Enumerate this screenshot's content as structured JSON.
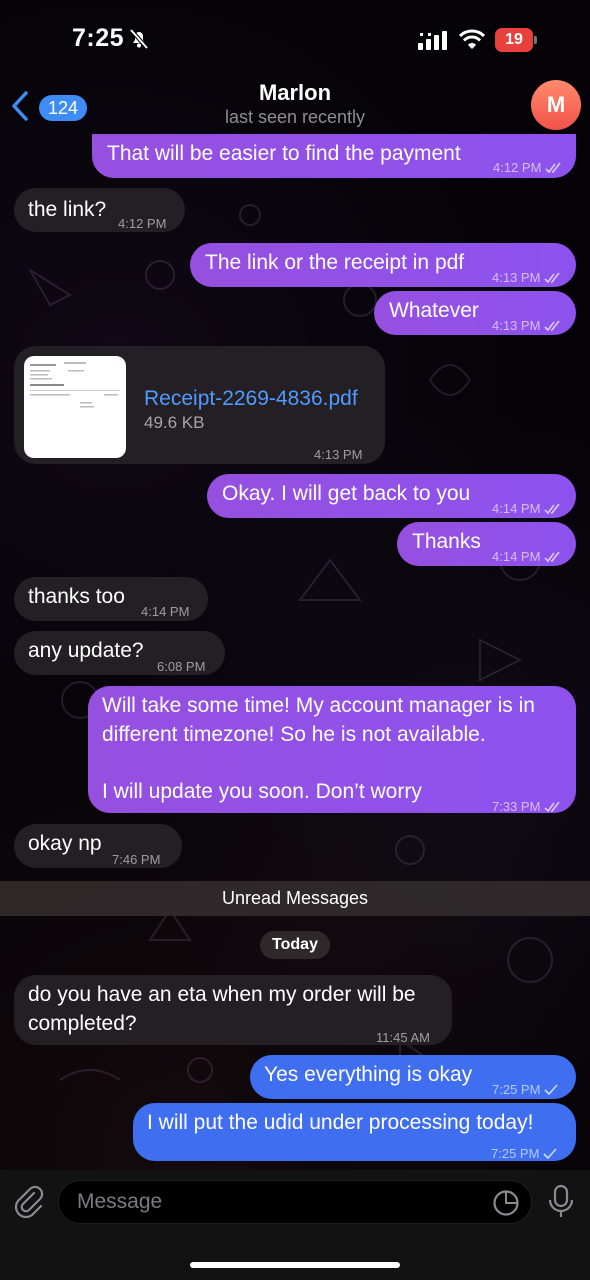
{
  "status_bar": {
    "time": "7:25",
    "battery": "19"
  },
  "header": {
    "unread_count": "124",
    "contact_name": "Marlon",
    "contact_status": "last seen recently",
    "avatar_initial": "M"
  },
  "messages": [
    {
      "text": "That will be easier to find the payment",
      "time": "4:12 PM",
      "direction": "out"
    },
    {
      "text": "the link?",
      "time": "4:12 PM",
      "direction": "in"
    },
    {
      "text": "The link or the receipt in pdf",
      "time": "4:13 PM",
      "direction": "out"
    },
    {
      "text": "Whatever",
      "time": "4:13 PM",
      "direction": "out"
    },
    {
      "file_name": "Receipt-2269-4836.pdf",
      "file_size": "49.6 KB",
      "time": "4:13 PM",
      "direction": "in"
    },
    {
      "text": "Okay. I will get back to you",
      "time": "4:14 PM",
      "direction": "out"
    },
    {
      "text": "Thanks",
      "time": "4:14 PM",
      "direction": "out"
    },
    {
      "text": "thanks too",
      "time": "4:14 PM",
      "direction": "in"
    },
    {
      "text": "any update?",
      "time": "6:08 PM",
      "direction": "in"
    },
    {
      "line1": "Will take some time! My account manager is in",
      "line2": "different timezone! So he is not available.",
      "line3": "I will update you soon. Don’t worry",
      "time": "7:33 PM",
      "direction": "out"
    },
    {
      "text": "okay np",
      "time": "7:46 PM",
      "direction": "in"
    },
    {
      "line1": "do you have an eta when my order will be",
      "line2": "completed?",
      "time": "11:45 AM",
      "direction": "in"
    },
    {
      "text": "Yes everything is okay",
      "time": "7:25 PM",
      "direction": "out"
    },
    {
      "text": "I will put the udid under processing today!",
      "time": "7:25 PM",
      "direction": "out"
    }
  ],
  "dividers": {
    "unread": "Unread Messages",
    "date": "Today"
  },
  "input": {
    "placeholder": "Message"
  },
  "colors": {
    "outgoing": "#8f51ea",
    "outgoing_recent": "#3f6ef0",
    "incoming": "#262226",
    "link": "#4f9bff",
    "badge": "#3e8df5"
  }
}
